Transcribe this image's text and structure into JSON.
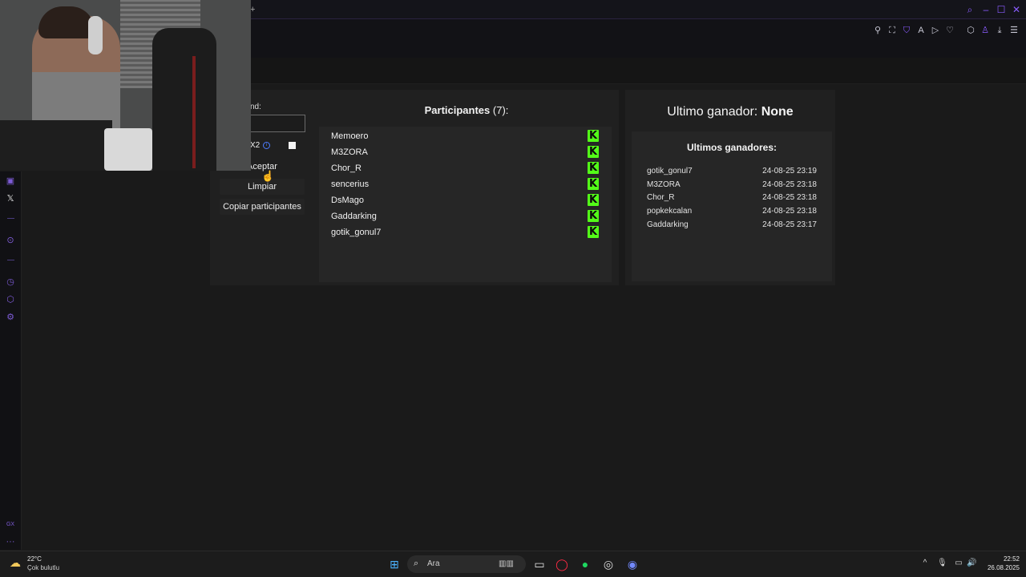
{
  "colors": {
    "accent": "#8a5cff",
    "kick_green": "#53fc18",
    "panel": "#202020",
    "box": "#262626"
  },
  "browser": {
    "new_tab": "+",
    "toolbar_icons": [
      "pin-icon",
      "crop-icon",
      "shield-icon",
      "translate-icon",
      "play-icon",
      "heart-icon",
      "extensions-icon",
      "profile-icon",
      "download-icon",
      "menu-icon"
    ]
  },
  "sidebar": {
    "icons": [
      "twitch-icon",
      "x-icon",
      "player-icon",
      "history-icon",
      "extensions-icon",
      "settings-icon",
      "gx-icon",
      "more-icon"
    ],
    "gx_label": "GX",
    "more_label": "···"
  },
  "controls": {
    "code_label": "nd:",
    "code_value": "",
    "x2_label": "X2",
    "accept_label": "Aceptar",
    "clear_label": "Limpiar",
    "copy_label": "Copiar participantes"
  },
  "participants": {
    "title": "Participantes",
    "count": "(7):",
    "items": [
      "Memoero",
      "M3ZORA",
      "Chor_R",
      "sencerius",
      "DsMago",
      "Gaddarking",
      "gotik_gonul7"
    ],
    "platform_logo": "K"
  },
  "winners": {
    "last_label": "Ultimo ganador:",
    "last_value": "None",
    "list_title": "Ultimos ganadores:",
    "items": [
      {
        "name": "gotik_gonul7",
        "time": "24-08-25 23:19"
      },
      {
        "name": "M3ZORA",
        "time": "24-08-25 23:18"
      },
      {
        "name": "Chor_R",
        "time": "24-08-25 23:18"
      },
      {
        "name": "popkekcalan",
        "time": "24-08-25 23:18"
      },
      {
        "name": "Gaddarking",
        "time": "24-08-25 23:17"
      }
    ]
  },
  "taskbar": {
    "weather_temp": "22°C",
    "weather_desc": "Çok bulutlu",
    "search_placeholder": "Ara",
    "clock_time": "22:52",
    "clock_date": "26.08.2025",
    "apps": [
      "windows-start-icon",
      "search-icon",
      "file-explorer-icon",
      "opera-gx-icon",
      "spotify-icon",
      "obs-icon",
      "discord-icon"
    ]
  }
}
